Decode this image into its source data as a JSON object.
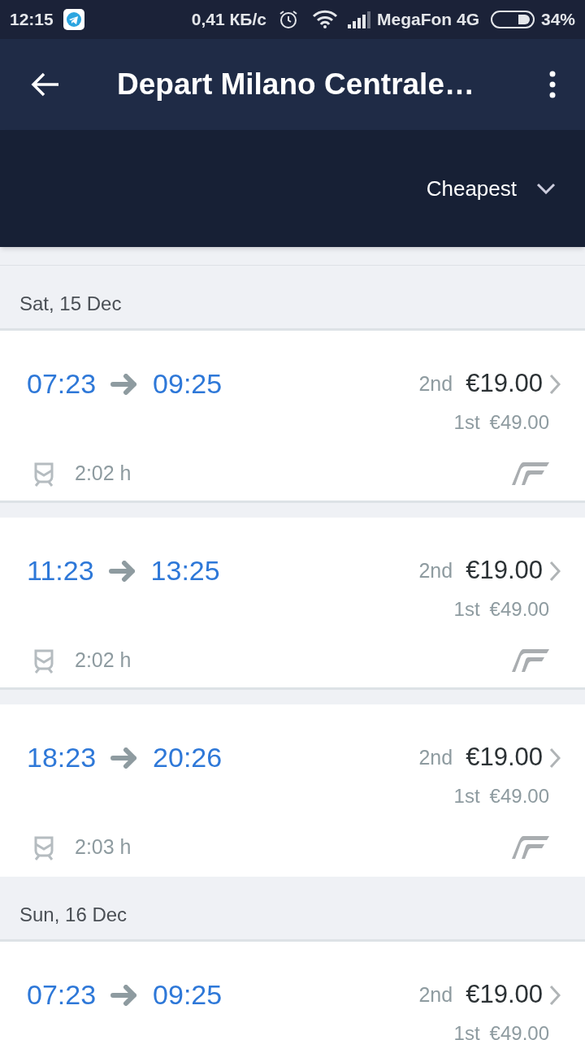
{
  "status_bar": {
    "time": "12:15",
    "speed": "0,41 КБ/с",
    "carrier": "MegaFon 4G",
    "battery": "34%"
  },
  "toolbar": {
    "title": "Depart Milano Centrale…"
  },
  "sort": {
    "label": "Cheapest"
  },
  "days": [
    {
      "date": "Sat, 15 Dec",
      "trips": [
        {
          "depart": "07:23",
          "arrive": "09:25",
          "second_label": "2nd",
          "second_price": "€19.00",
          "first_label": "1st",
          "first_price": "€49.00",
          "duration": "2:02 h"
        },
        {
          "depart": "11:23",
          "arrive": "13:25",
          "second_label": "2nd",
          "second_price": "€19.00",
          "first_label": "1st",
          "first_price": "€49.00",
          "duration": "2:02 h"
        },
        {
          "depart": "18:23",
          "arrive": "20:26",
          "second_label": "2nd",
          "second_price": "€19.00",
          "first_label": "1st",
          "first_price": "€49.00",
          "duration": "2:03 h"
        }
      ]
    },
    {
      "date": "Sun, 16 Dec",
      "trips": [
        {
          "depart": "07:23",
          "arrive": "09:25",
          "second_label": "2nd",
          "second_price": "€19.00",
          "first_label": "1st",
          "first_price": "€49.00"
        }
      ]
    }
  ]
}
